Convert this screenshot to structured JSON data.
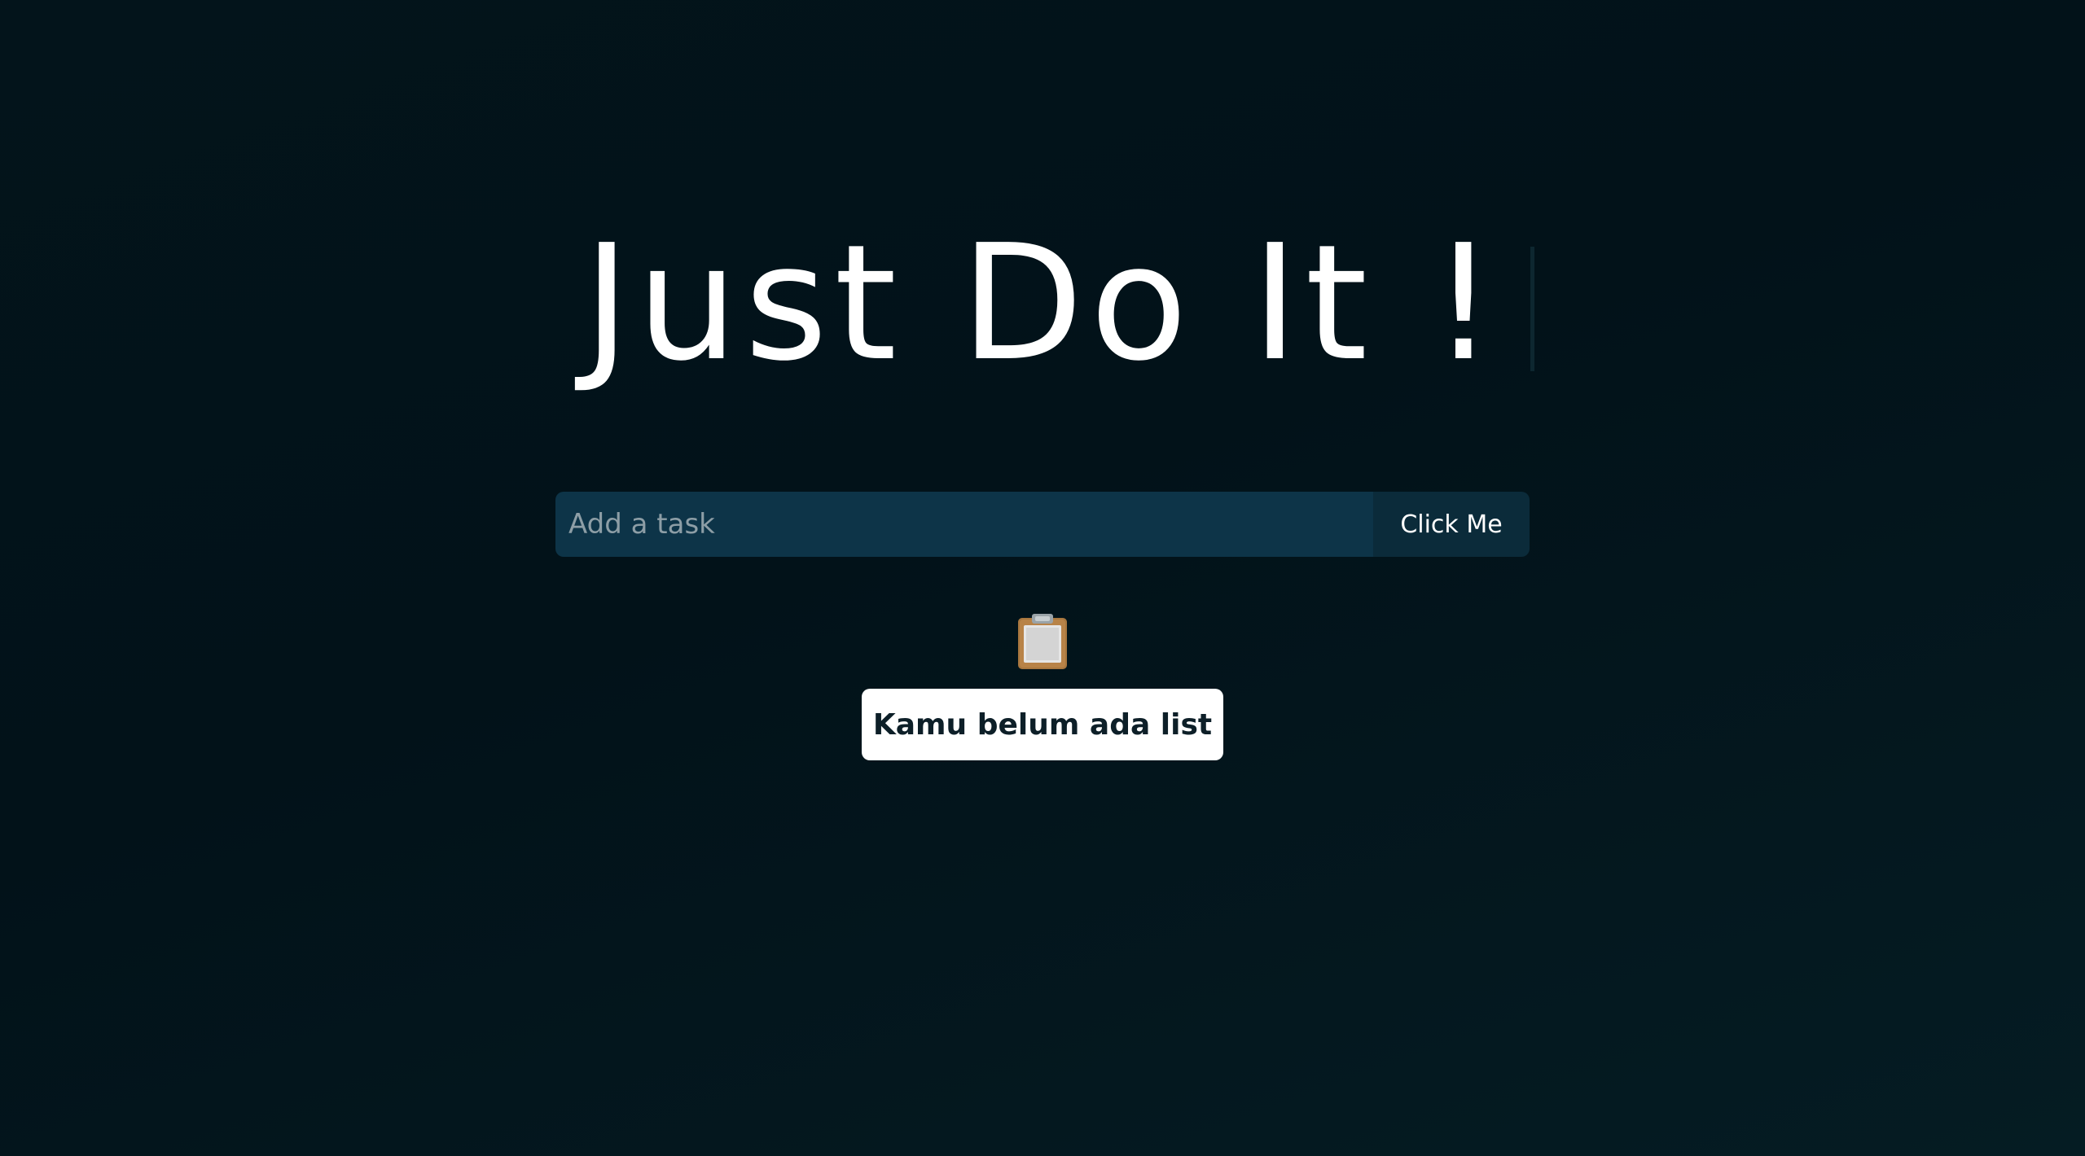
{
  "header": {
    "title": "Just Do It !"
  },
  "task_form": {
    "input_value": "",
    "input_placeholder": "Add a task",
    "button_label": "Click Me"
  },
  "empty_state": {
    "icon": "clipboard-icon",
    "message": "Kamu belum ada list"
  },
  "colors": {
    "background": "#021219",
    "input_background": "#0d3448",
    "button_background": "#0b2b3a",
    "badge_background": "#ffffff",
    "badge_text": "#0d1f28"
  }
}
